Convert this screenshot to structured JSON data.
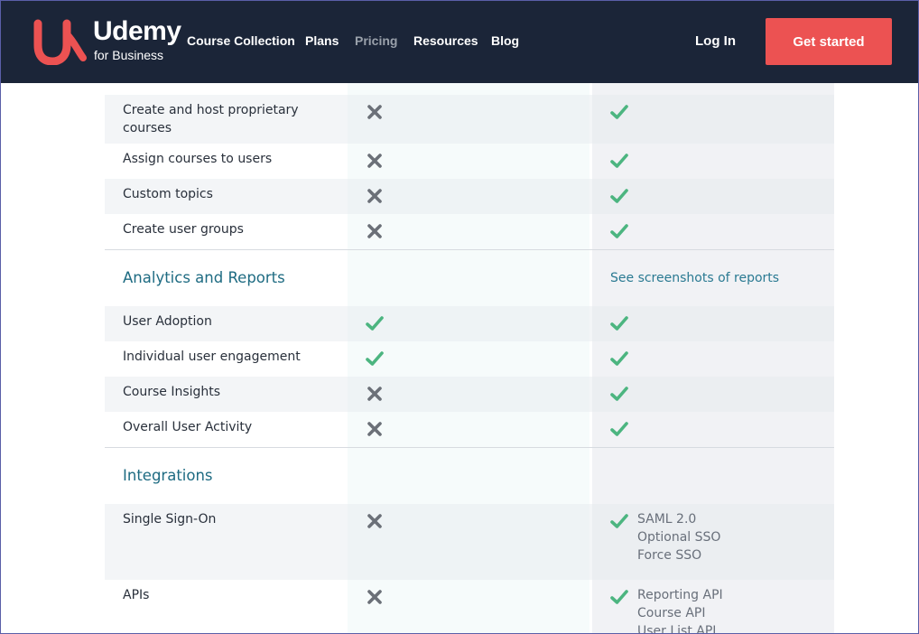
{
  "header": {
    "brand": "Udemy",
    "brand_sub": "for Business",
    "nav": [
      "Course Collection",
      "Plans",
      "Pricing",
      "Resources",
      "Blog"
    ],
    "login": "Log In",
    "cta": "Get started"
  },
  "rows": {
    "proprietary": "Create and host proprietary courses",
    "assign": "Assign courses to users",
    "topics": "Custom topics",
    "groups": "Create user groups",
    "analytics_title": "Analytics and Reports",
    "analytics_link": "See screenshots of reports",
    "adoption": "User Adoption",
    "engagement": "Individual user engagement",
    "insights": "Course Insights",
    "activity": "Overall User Activity",
    "integrations_title": "Integrations",
    "sso": "Single Sign-On",
    "sso_details": [
      "SAML 2.0",
      "Optional SSO",
      "Force SSO"
    ],
    "apis": "APIs",
    "api_details": [
      "Reporting API",
      "Course API",
      "User List API"
    ]
  },
  "colors": {
    "check": "#4cb580",
    "cross": "#6b7078",
    "accent": "#ec5252",
    "header": "#1b2538"
  }
}
